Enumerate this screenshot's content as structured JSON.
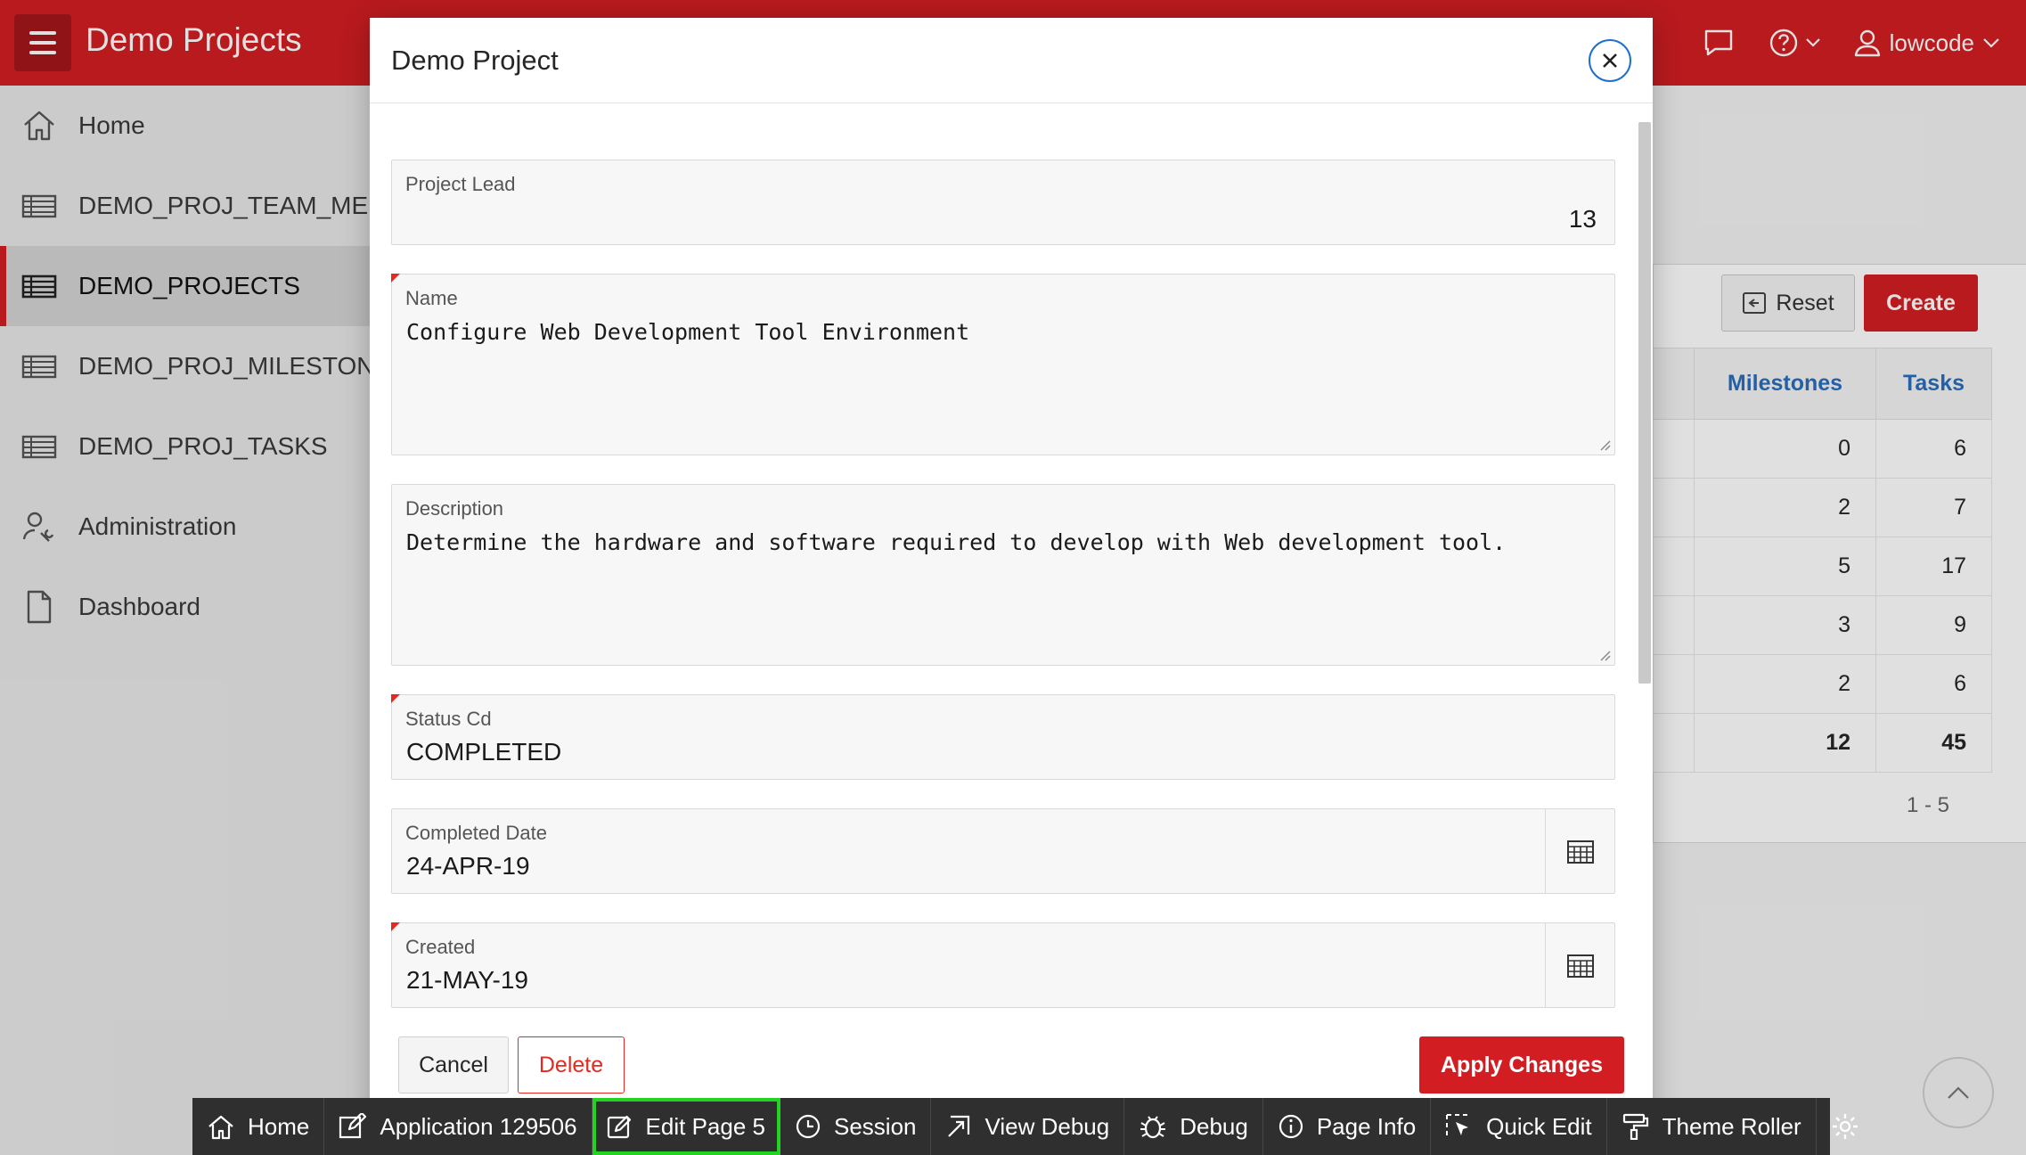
{
  "header": {
    "app_title": "Demo Projects",
    "username": "lowcode"
  },
  "sidebar": {
    "items": [
      {
        "label": "Home",
        "icon": "home-icon"
      },
      {
        "label": "DEMO_PROJ_TEAM_MEM",
        "icon": "table-icon"
      },
      {
        "label": "DEMO_PROJECTS",
        "icon": "table-icon",
        "active": true
      },
      {
        "label": "DEMO_PROJ_MILESTONE",
        "icon": "table-icon"
      },
      {
        "label": "DEMO_PROJ_TASKS",
        "icon": "table-icon"
      },
      {
        "label": "Administration",
        "icon": "user-wrench-icon"
      },
      {
        "label": "Dashboard",
        "icon": "file-icon"
      }
    ]
  },
  "background_report": {
    "reset_label": "Reset",
    "create_label": "Create",
    "columns": [
      "Milestones",
      "Tasks"
    ],
    "rows": [
      [
        "0",
        "6"
      ],
      [
        "2",
        "7"
      ],
      [
        "5",
        "17"
      ],
      [
        "3",
        "9"
      ],
      [
        "2",
        "6"
      ]
    ],
    "totals": [
      "12",
      "45"
    ],
    "pagination": "1 - 5"
  },
  "modal": {
    "title": "Demo Project",
    "fields": {
      "project_lead": {
        "label": "Project Lead",
        "value": "13"
      },
      "name": {
        "label": "Name",
        "value": "Configure Web Development Tool Environment"
      },
      "description": {
        "label": "Description",
        "value": "Determine the hardware and software required to develop with Web development tool."
      },
      "status_cd": {
        "label": "Status Cd",
        "value": "COMPLETED"
      },
      "completed_date": {
        "label": "Completed Date",
        "value": "24-APR-19"
      },
      "created": {
        "label": "Created",
        "value": "21-MAY-19"
      }
    },
    "buttons": {
      "cancel": "Cancel",
      "delete": "Delete",
      "apply": "Apply Changes"
    }
  },
  "dev_toolbar": {
    "items": [
      {
        "label": "Home",
        "icon": "home-icon"
      },
      {
        "label": "Application 129506",
        "icon": "edit-icon"
      },
      {
        "label": "Edit Page 5",
        "icon": "pencil-icon",
        "highlighted": true
      },
      {
        "label": "Session",
        "icon": "clock-icon"
      },
      {
        "label": "View Debug",
        "icon": "external-icon"
      },
      {
        "label": "Debug",
        "icon": "bug-icon"
      },
      {
        "label": "Page Info",
        "icon": "info-icon"
      },
      {
        "label": "Quick Edit",
        "icon": "cursor-select-icon"
      },
      {
        "label": "Theme Roller",
        "icon": "paint-roller-icon"
      }
    ]
  },
  "colors": {
    "brand": "#d21e23",
    "highlight": "#22d322",
    "link": "#2a6ebd"
  }
}
